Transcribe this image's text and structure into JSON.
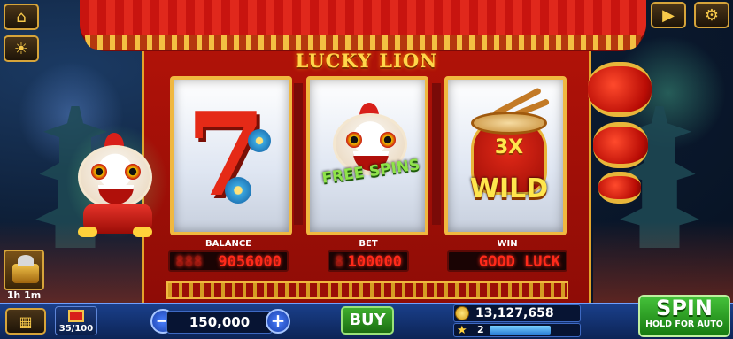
{
  "game": {
    "title": "LUCKY LION"
  },
  "reels": [
    {
      "symbol": "7",
      "icon": "red-seven"
    },
    {
      "symbol_text": "FREE SPINS",
      "icon": "lion-dance-head"
    },
    {
      "multiplier": "3X",
      "symbol_text": "WILD",
      "icon": "drum"
    }
  ],
  "meters": {
    "balance_label": "BALANCE",
    "balance_value": "9056000",
    "bet_label": "BET",
    "bet_value": "100000",
    "win_label": "WIN",
    "win_value": "GOOD LUCK"
  },
  "top_left": {
    "home_icon": "home-icon",
    "sun_icon": "sun-icon"
  },
  "top_right": {
    "video_icon": "video-icon",
    "settings_icon": "gear-icon"
  },
  "bonus": {
    "timer": "1h  1m",
    "icon": "treasure-chest-icon"
  },
  "bottom": {
    "menu_icon": "grid-menu-icon",
    "gift_progress": "35/100",
    "bet_amount": "150,000",
    "minus_label": "−",
    "plus_label": "+",
    "buy_label": "BUY",
    "coins": "13,127,658",
    "level": "2",
    "level_progress": 0.72,
    "spin_label": "SPIN",
    "spin_sub_label": "HOLD FOR AUTO"
  },
  "colors": {
    "accent_gold": "#f0b840",
    "frame_red": "#b01208",
    "meter_red": "#ff2a1a",
    "spin_green": "#45c23a"
  }
}
